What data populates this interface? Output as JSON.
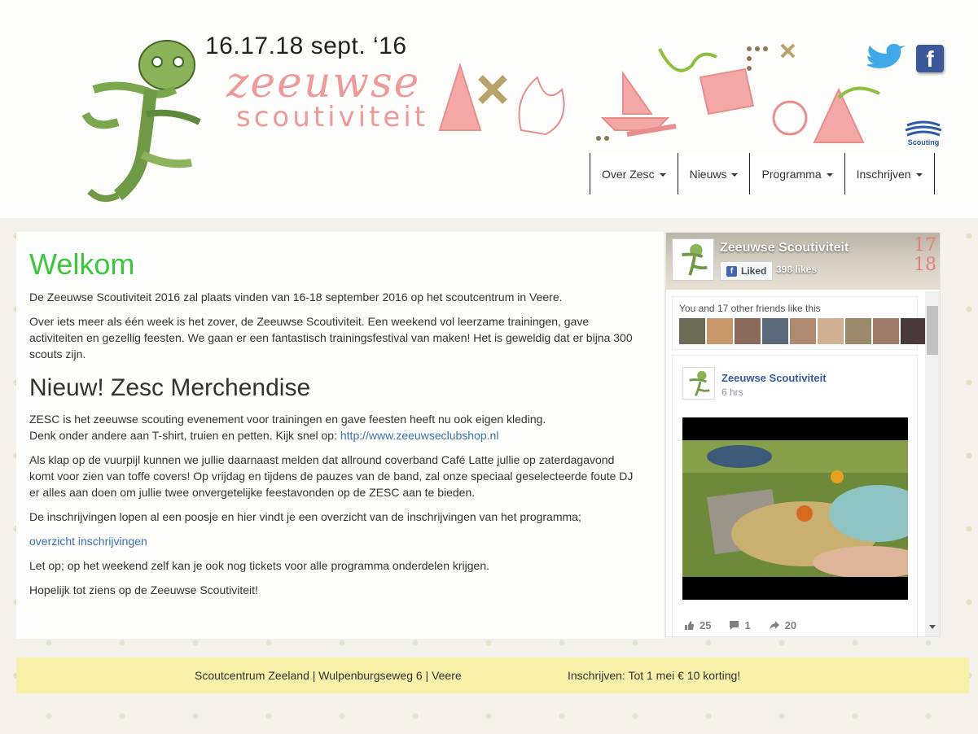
{
  "header": {
    "event_date": "16.17.18 sept. ‘16",
    "brand_line1": "zeeuwse",
    "brand_line2": "scoutiviteit",
    "icons": [
      "twitter-icon",
      "facebook-icon",
      "scouting-logo"
    ],
    "scouting_logo_text": "Scouting",
    "facebook_glyph": "f"
  },
  "nav": {
    "items": [
      {
        "label": "Over Zesc"
      },
      {
        "label": "Nieuws"
      },
      {
        "label": "Programma"
      },
      {
        "label": "Inschrijven"
      }
    ]
  },
  "main": {
    "welcome_title": "Welkom",
    "intro": "De Zeeuwse Scoutiviteit 2016 zal plaats vinden van 16-18 september 2016 op het scoutcentrum in Veere.",
    "para2": "Over iets meer als één week is het zover, de Zeeuwse Scoutiviteit. Een weekend vol leerzame trainingen, gave activiteiten en gezellig feesten. We gaan er een fantastisch trainingsfestival van maken! Het is geweldig dat er bijna 300 scouts zijn.",
    "merch_title": "Nieuw! Zesc Merchendise",
    "merch_line1": "ZESC is het zeeuwse scouting evenement voor trainingen en gave feesten heeft nu ook eigen kleding.",
    "merch_line2": "Denk onder andere aan T-shirt, truien en petten. Kijk snel op: ",
    "shop_link": "http://www.zeeuwseclubshop.nl",
    "band_para": "Als klap op de vuurpijl kunnen we jullie daarnaast melden dat allround coverband Café Latte jullie op zaterdagavond komt voor zien van toffe covers! Op vrijdag en tijdens de pauzes van de band, zal onze speciaal geselecteerde foute DJ er alles aan doen om jullie twee onvergetelijke feestavonden op de ZESC aan te bieden.",
    "registration_para": "De inschrijvingen lopen al een poosje en hier vindt je een overzicht van de inschrijvingen van het programma;",
    "registration_link": "overzicht inschrijvingen",
    "tickets_para": "Let op; op het weekend zelf kan je ook nog tickets voor alle programma onderdelen krijgen.",
    "closing": "Hopelijk tot ziens op de Zeeuwse Scoutiviteit!"
  },
  "fb_widget": {
    "cover_deco_line1": "17",
    "cover_deco_line2": "18",
    "page_name": "Zeeuwse Scoutiviteit",
    "liked_label": "Liked",
    "like_count": "398 likes",
    "friends_text": "You and 17 other friends like this",
    "post": {
      "author": "Zeeuwse Scoutiviteit",
      "time": "6 hrs",
      "likes": "25",
      "comments": "1",
      "shares": "20"
    }
  },
  "footer": {
    "address": "Scoutcentrum Zeeland | Wulpenburgseweg 6 | Veere",
    "promo": "Inschrijven: Tot 1 mei € 10 korting!"
  },
  "colors": {
    "accent_green": "#3cc63c",
    "brand_pink": "#ef9a9a",
    "link_blue": "#3c6fb4",
    "footer_yellow": "#f7f0a8",
    "facebook_blue": "#3b5998"
  }
}
